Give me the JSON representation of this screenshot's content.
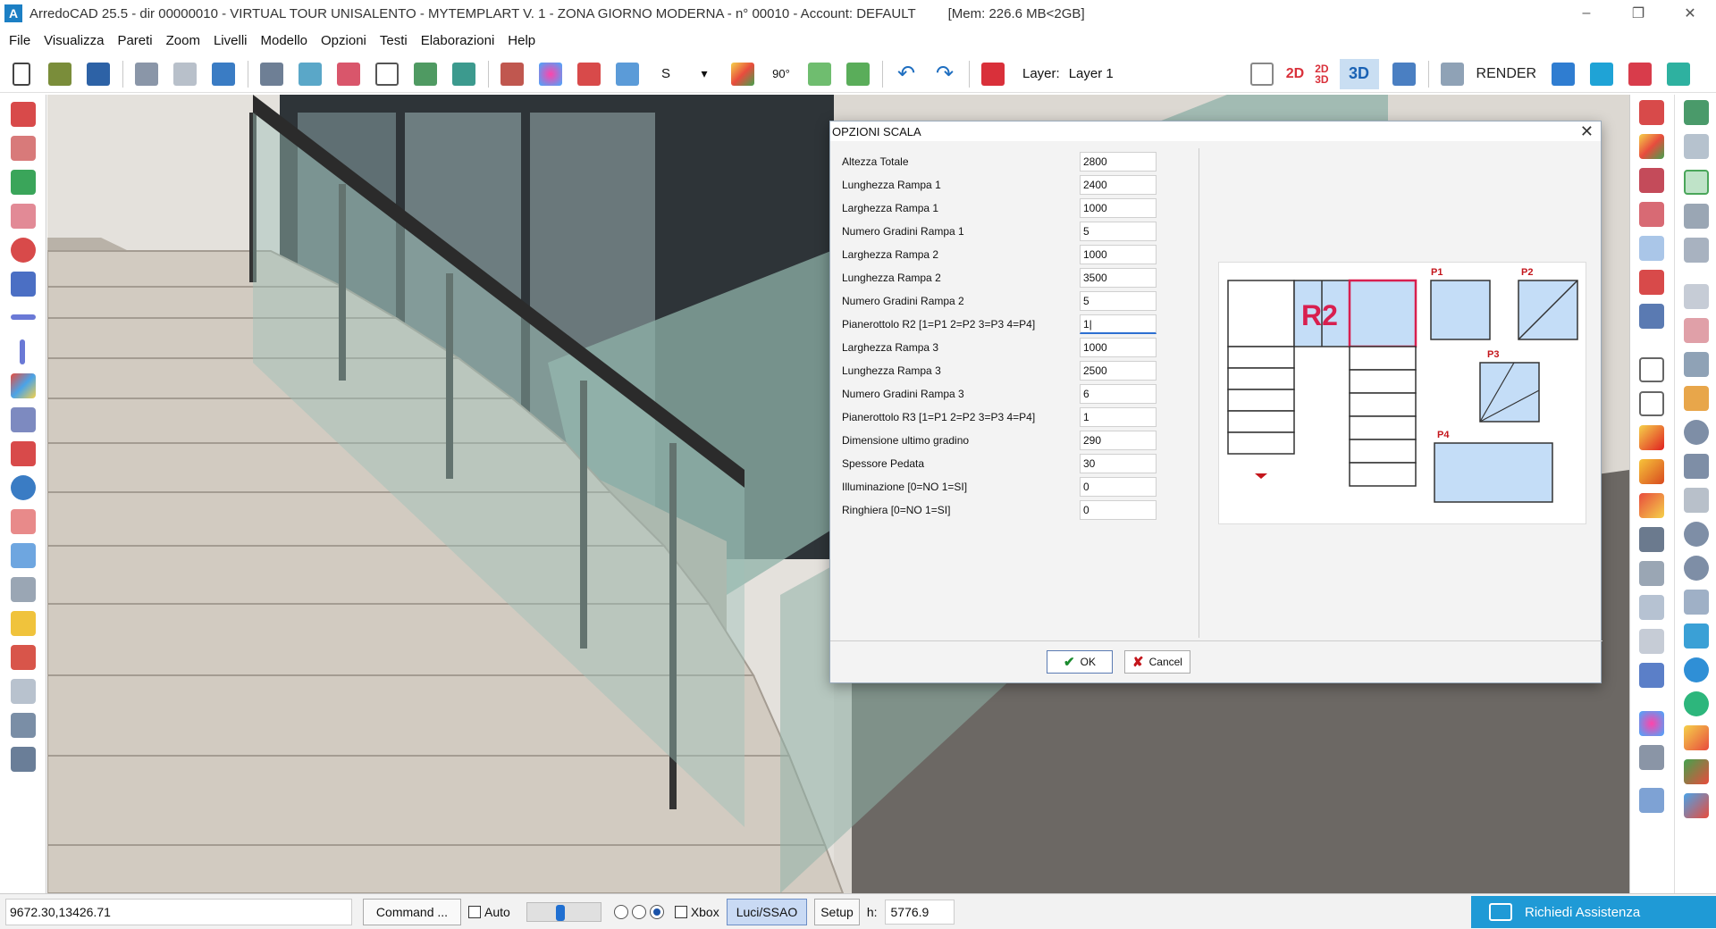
{
  "window": {
    "title": "ArredoCAD 25.5 - dir 00000010 - VIRTUAL TOUR UNISALENTO - MYTEMPLART V. 1 - ZONA GIORNO MODERNA - n° 00010 - Account: DEFAULT",
    "memory": "[Mem: 226.6 MB<2GB]",
    "app_icon_letter": "A",
    "controls": {
      "minimize": "–",
      "maximize": "❐",
      "close": "✕"
    }
  },
  "menu": [
    "File",
    "Visualizza",
    "Pareti",
    "Zoom",
    "Livelli",
    "Modello",
    "Opzioni",
    "Testi",
    "Elaborazioni",
    "Help"
  ],
  "toolbar": {
    "s_label": "S",
    "angle_label": "90°",
    "layer_label": "Layer:",
    "layer_value": "Layer 1",
    "view_2d": "2D",
    "view_2d3d_top": "2D",
    "view_2d3d_bottom": "3D",
    "view_3d": "3D",
    "render_label": "RENDER",
    "accent_blue": "#1a62b4",
    "accent_red": "#d9303a"
  },
  "dialog": {
    "title": "OPZIONI SCALA",
    "close": "✕",
    "fields": [
      {
        "label": "Altezza Totale",
        "value": "2800"
      },
      {
        "label": "Lunghezza Rampa 1",
        "value": "2400"
      },
      {
        "label": "Larghezza Rampa 1",
        "value": "1000"
      },
      {
        "label": "Numero Gradini Rampa 1",
        "value": "5"
      },
      {
        "label": "Larghezza Rampa 2",
        "value": "1000"
      },
      {
        "label": "Lunghezza Rampa 2",
        "value": "3500"
      },
      {
        "label": "Numero Gradini Rampa 2",
        "value": "5"
      },
      {
        "label": "Pianerottolo R2 [1=P1 2=P2 3=P3 4=P4]",
        "value": "1|"
      },
      {
        "label": "Larghezza Rampa 3",
        "value": "1000"
      },
      {
        "label": "Lunghezza Rampa 3",
        "value": "2500"
      },
      {
        "label": "Numero Gradini Rampa 3",
        "value": "6"
      },
      {
        "label": "Pianerottolo R3 [1=P1 2=P2 3=P3 4=P4]",
        "value": "1"
      },
      {
        "label": "Dimensione ultimo gradino",
        "value": "290"
      },
      {
        "label": "Spessore Pedata",
        "value": "30"
      },
      {
        "label": "Illuminazione [0=NO 1=SI]",
        "value": "0"
      },
      {
        "label": "Ringhiera [0=NO 1=SI]",
        "value": "0"
      }
    ],
    "preview": {
      "r2_label": "R2",
      "p1_label": "P1",
      "p2_label": "P2",
      "p3_label": "P3",
      "p4_label": "P4",
      "fill_color": "#c4ddf7",
      "highlight_color": "#d81f4f"
    },
    "ok_label": "OK",
    "cancel_label": "Cancel"
  },
  "status": {
    "coords": "9672.30,13426.71",
    "command_label": "Command ...",
    "auto_label": "Auto",
    "slider_level": 0.45,
    "radio_selected": 3,
    "xbox_label": "Xbox",
    "luci_label": "Luci/SSAO",
    "setup_label": "Setup",
    "h_label": "h:",
    "h_value": "5776.9",
    "assist_label": "Richiedi Assistenza"
  }
}
